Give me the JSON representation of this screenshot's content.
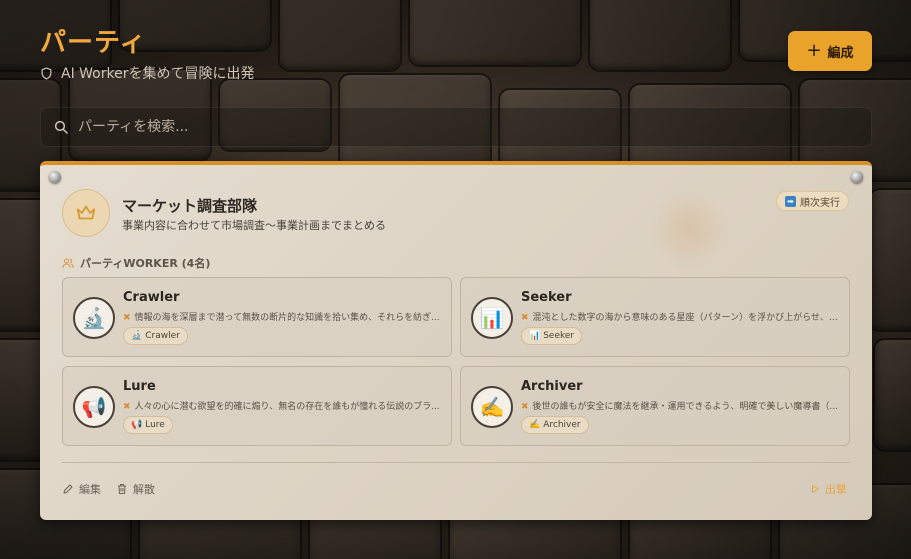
{
  "header": {
    "title": "パーティ",
    "subtitle": "AI Workerを集めて冒険に出発",
    "form_button_label": "編成"
  },
  "search": {
    "placeholder": "パーティを検索..."
  },
  "party": {
    "name": "マーケット調査部隊",
    "description": "事業内容に合わせて市場調査～事業計画までまとめる",
    "order_badge": "順次実行",
    "members_heading": "パーティWORKER (4名)",
    "workers": [
      {
        "name": "Crawler",
        "icon": "microscope-icon",
        "icon_glyph": "🔬",
        "description": "情報の海を深層まで潜って無数の断片的な知識を拾い集め、それらを紡ぎ...",
        "tag": "Crawler"
      },
      {
        "name": "Seeker",
        "icon": "bar-chart-icon",
        "icon_glyph": "📊",
        "description": "混沌とした数字の海から意味のある星座（パターン）を浮かび上がらせ、迷...",
        "tag": "Seeker"
      },
      {
        "name": "Lure",
        "icon": "megaphone-icon",
        "icon_glyph": "📢",
        "description": "人々の心に潜む欲望を的確に煽り、無名の存在を誰もが憧れる伝説のブラ...",
        "tag": "Lure"
      },
      {
        "name": "Archiver",
        "icon": "writing-hand-icon",
        "icon_glyph": "✍️",
        "description": "後世の誰もが安全に魔法を継承・運用できるよう、明確で美しい魔導書（...",
        "tag": "Archiver"
      }
    ],
    "actions": {
      "edit": "編集",
      "disband": "解散",
      "sortie": "出撃"
    }
  },
  "colors": {
    "accent": "#e9a22a",
    "title": "#f2a93b"
  }
}
